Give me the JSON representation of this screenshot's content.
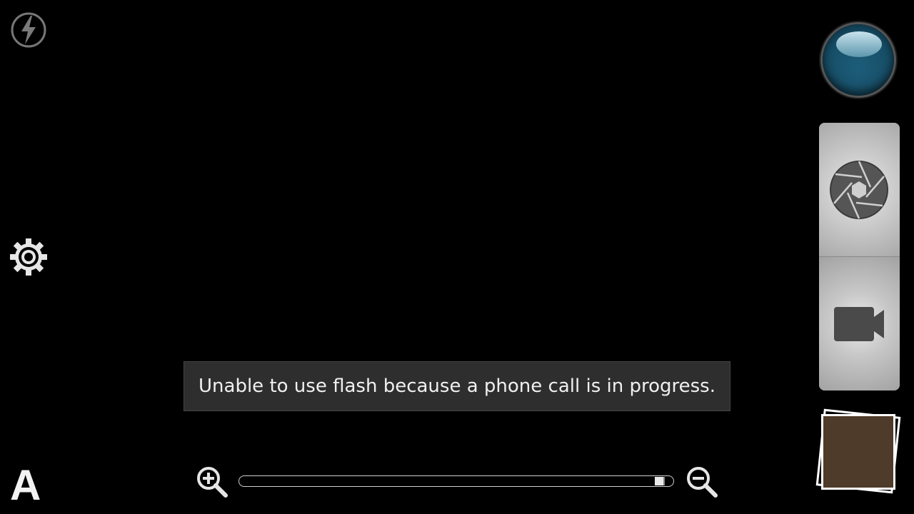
{
  "toast": {
    "message": "Unable to use flash because a phone call is in progress."
  },
  "controls": {
    "flash_icon": "flash-off-icon",
    "settings_icon": "gear-icon",
    "scene_mode_label": "A",
    "zoom_in_icon": "zoom-in-icon",
    "zoom_out_icon": "zoom-out-icon",
    "capture_icon": "capture-orb-icon",
    "photo_mode_icon": "camera-shutter-icon",
    "video_mode_icon": "video-camera-icon",
    "thumbnail_icon": "last-photo-thumbnail"
  },
  "zoom": {
    "level": 0.98
  },
  "colors": {
    "background": "#000000",
    "toast_bg": "#2e2e2e",
    "orb_blue": "#1d5d7a",
    "thumbnail_fill": "#4e3b2a"
  }
}
